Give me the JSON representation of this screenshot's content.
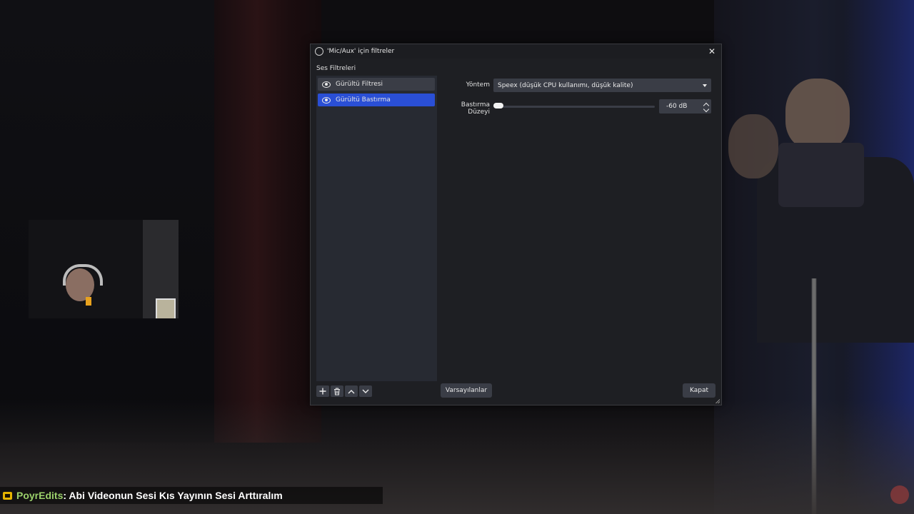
{
  "dialog": {
    "title": "'Mic/Aux' için filtreler",
    "section_label": "Ses Filtreleri",
    "filters": [
      {
        "label": "Gürültü Filtresi",
        "visible_icon": "eye-icon",
        "selected": false
      },
      {
        "label": "Gürültü Bastırma",
        "visible_icon": "eye-icon",
        "selected": true
      }
    ],
    "properties": {
      "method_label": "Yöntem",
      "method_value": "Speex (düşük CPU kullanımı, düşük kalite)",
      "level_label": "Bastırma Düzeyi",
      "level_value": "-60 dB",
      "level_slider_fraction": 0.02
    },
    "toolbar_icons": [
      "plus-icon",
      "trash-icon",
      "chevron-up-icon",
      "chevron-down-icon"
    ],
    "defaults_button": "Varsayılanlar",
    "close_button": "Kapat",
    "colors": {
      "selected": "#2a4fd6",
      "panel": "#272a32",
      "control": "#3a3d46"
    }
  },
  "chat": {
    "username": "PoyrEdits",
    "message": ": Abi Videonun Sesi Kıs Yayının Sesi Arttıralım",
    "username_color": "#9bd16b"
  }
}
